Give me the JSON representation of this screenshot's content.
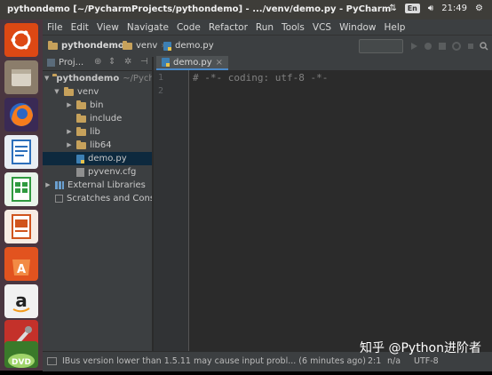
{
  "topbar": {
    "window_title": "pythondemo [~/PycharmProjects/pythondemo] - .../venv/demo.py - PyCharm",
    "keyboard": "En",
    "time": "21:49"
  },
  "launcher": {
    "items": [
      "ubuntu-dash",
      "files",
      "firefox",
      "libreoffice-writer",
      "libreoffice-calc",
      "libreoffice-impress",
      "ubuntu-software",
      "amazon",
      "settings",
      "dvd"
    ]
  },
  "menu": [
    "File",
    "Edit",
    "View",
    "Navigate",
    "Code",
    "Refactor",
    "Run",
    "Tools",
    "VCS",
    "Window",
    "Help"
  ],
  "breadcrumb": [
    "pythondemo",
    "venv",
    "demo.py"
  ],
  "project_panel": {
    "header": "Proj...",
    "tree": [
      {
        "label": "pythondemo",
        "suffix": "~/Pych",
        "depth": 0,
        "expanded": true,
        "type": "folder"
      },
      {
        "label": "venv",
        "depth": 1,
        "expanded": true,
        "type": "folder"
      },
      {
        "label": "bin",
        "depth": 2,
        "expanded": false,
        "type": "folder"
      },
      {
        "label": "include",
        "depth": 2,
        "type": "folder"
      },
      {
        "label": "lib",
        "depth": 2,
        "expanded": false,
        "type": "folder"
      },
      {
        "label": "lib64",
        "depth": 2,
        "expanded": false,
        "type": "folder"
      },
      {
        "label": "demo.py",
        "depth": 2,
        "type": "pyfile",
        "selected": true
      },
      {
        "label": "pyvenv.cfg",
        "depth": 2,
        "type": "cfg"
      },
      {
        "label": "External Libraries",
        "depth": 0,
        "expanded": false,
        "type": "lib"
      },
      {
        "label": "Scratches and Console",
        "depth": 0,
        "type": "scratch"
      }
    ]
  },
  "editor": {
    "tab_label": "demo.py",
    "tab_close": "×",
    "line_numbers": [
      "1",
      "2"
    ],
    "lines": [
      "# -*- coding: utf-8 -*-",
      ""
    ]
  },
  "status": {
    "message": "IBus version lower than 1.5.11 may cause input probl... (6 minutes ago)",
    "position": "2:1",
    "line_sep": "n/a",
    "encoding": "UTF-8"
  },
  "watermark": "知乎 @Python进阶者"
}
